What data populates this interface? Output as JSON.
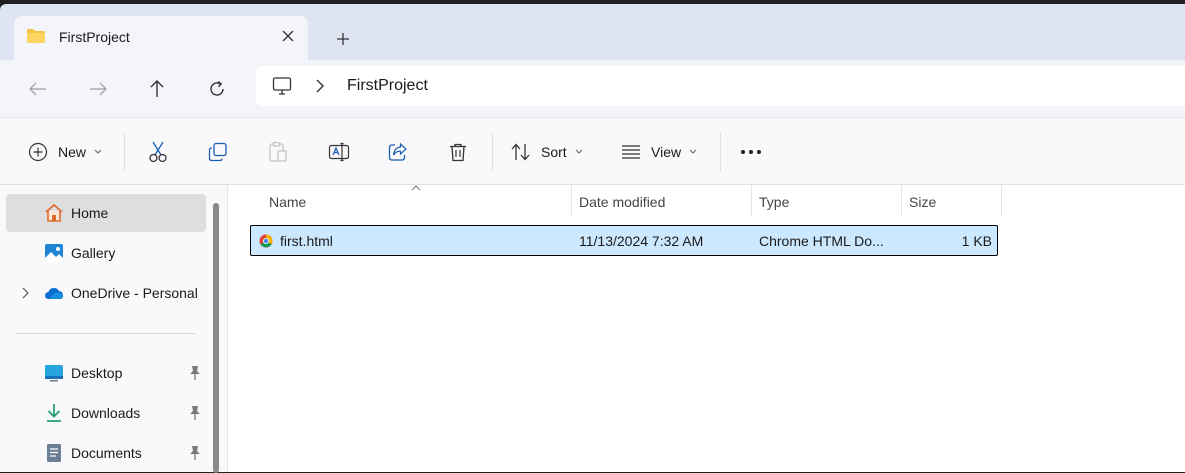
{
  "tab": {
    "title": "FirstProject",
    "icon": "folder-icon"
  },
  "address": {
    "path_segment": "FirstProject",
    "root_icon": "this-pc-icon"
  },
  "commands": {
    "new_label": "New",
    "sort_label": "Sort",
    "view_label": "View"
  },
  "sidebar": {
    "items": [
      {
        "label": "Home",
        "icon": "home-icon"
      },
      {
        "label": "Gallery",
        "icon": "gallery-icon"
      },
      {
        "label": "OneDrive - Personal",
        "icon": "onedrive-icon"
      },
      {
        "label": "Desktop",
        "icon": "desktop-icon"
      },
      {
        "label": "Downloads",
        "icon": "downloads-icon"
      },
      {
        "label": "Documents",
        "icon": "documents-icon"
      }
    ]
  },
  "columns": {
    "name": "Name",
    "date": "Date modified",
    "type": "Type",
    "size": "Size"
  },
  "files": [
    {
      "name": "first.html",
      "date": "11/13/2024 7:32 AM",
      "type": "Chrome HTML Do...",
      "size": "1 KB"
    }
  ],
  "colors": {
    "accent": "#0078d4",
    "selection": "#cce8ff",
    "folder": "#f8c443"
  }
}
